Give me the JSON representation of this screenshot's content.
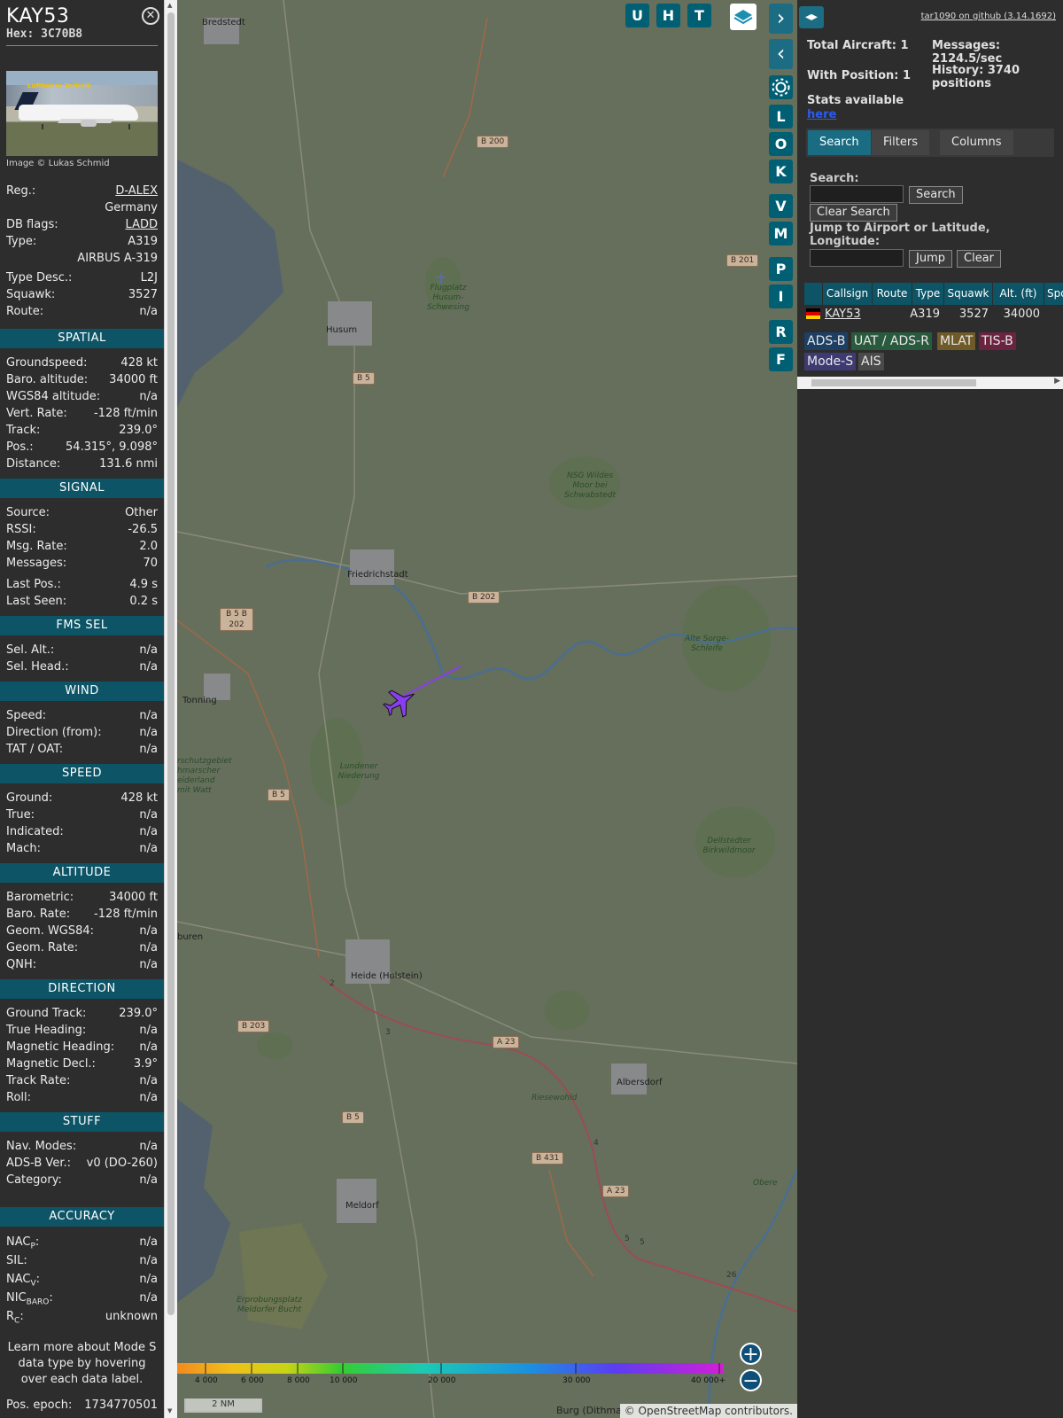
{
  "sidebar": {
    "callsign": "KAY53",
    "hex_label": "Hex:",
    "hex": "3C70B8",
    "close_icon": "close-icon",
    "photo_credit": "Image © Lukas Schmid",
    "photo_sign": "Lufthansa Technik",
    "info": [
      {
        "label": "Reg.:",
        "value": "D-ALEX",
        "link": true
      },
      {
        "label": "",
        "value": "Germany"
      },
      {
        "label": "DB flags:",
        "value": "LADD",
        "link": true
      },
      {
        "label": "Type:",
        "value": "A319"
      },
      {
        "label": "",
        "value": "AIRBUS A-319"
      }
    ],
    "info2": [
      {
        "label": "Type Desc.:",
        "value": "L2J"
      },
      {
        "label": "Squawk:",
        "value": "3527"
      },
      {
        "label": "Route:",
        "value": "n/a"
      }
    ],
    "sections": {
      "spatial": {
        "title": "SPATIAL",
        "rows": [
          {
            "label": "Groundspeed:",
            "value": "428 kt"
          },
          {
            "label": "Baro. altitude:",
            "value": "34000 ft"
          },
          {
            "label": "WGS84 altitude:",
            "value": "n/a"
          },
          {
            "label": "Vert. Rate:",
            "value": "-128 ft/min"
          },
          {
            "label": "Track:",
            "value": "239.0°"
          },
          {
            "label": "Pos.:",
            "value": "54.315°, 9.098°"
          },
          {
            "label": "Distance:",
            "value": "131.6 nmi"
          }
        ]
      },
      "signal": {
        "title": "SIGNAL",
        "rows": [
          {
            "label": "Source:",
            "value": "Other"
          },
          {
            "label": "RSSI:",
            "value": "-26.5"
          },
          {
            "label": "Msg. Rate:",
            "value": "2.0"
          },
          {
            "label": "Messages:",
            "value": "70"
          }
        ],
        "rows2": [
          {
            "label": "Last Pos.:",
            "value": "4.9 s"
          },
          {
            "label": "Last Seen:",
            "value": "0.2 s"
          }
        ]
      },
      "fms": {
        "title": "FMS SEL",
        "rows": [
          {
            "label": "Sel. Alt.:",
            "value": "n/a"
          },
          {
            "label": "Sel. Head.:",
            "value": "n/a"
          }
        ]
      },
      "wind": {
        "title": "WIND",
        "rows": [
          {
            "label": "Speed:",
            "value": "n/a"
          },
          {
            "label": "Direction (from):",
            "value": "n/a"
          },
          {
            "label": "TAT / OAT:",
            "value": "n/a"
          }
        ]
      },
      "speed": {
        "title": "SPEED",
        "rows": [
          {
            "label": "Ground:",
            "value": "428 kt"
          },
          {
            "label": "True:",
            "value": "n/a"
          },
          {
            "label": "Indicated:",
            "value": "n/a"
          },
          {
            "label": "Mach:",
            "value": "n/a"
          }
        ]
      },
      "altitude": {
        "title": "ALTITUDE",
        "rows": [
          {
            "label": "Barometric:",
            "value": "34000 ft"
          },
          {
            "label": "Baro. Rate:",
            "value": "-128 ft/min"
          },
          {
            "label": "Geom. WGS84:",
            "value": "n/a"
          },
          {
            "label": "Geom. Rate:",
            "value": "n/a"
          },
          {
            "label": "QNH:",
            "value": "n/a"
          }
        ]
      },
      "direction": {
        "title": "DIRECTION",
        "rows": [
          {
            "label": "Ground Track:",
            "value": "239.0°"
          },
          {
            "label": "True Heading:",
            "value": "n/a"
          },
          {
            "label": "Magnetic Heading:",
            "value": "n/a"
          },
          {
            "label": "Magnetic Decl.:",
            "value": "3.9°"
          },
          {
            "label": "Track Rate:",
            "value": "n/a"
          },
          {
            "label": "Roll:",
            "value": "n/a"
          }
        ]
      },
      "stuff": {
        "title": "STUFF",
        "rows": [
          {
            "label": "Nav. Modes:",
            "value": "n/a"
          },
          {
            "label": "ADS-B Ver.:",
            "value": "v0 (DO-260)"
          },
          {
            "label": "Category:",
            "value": "n/a"
          }
        ]
      },
      "accuracy": {
        "title": "ACCURACY",
        "rows": [
          {
            "label": "NACP:",
            "value": "n/a"
          },
          {
            "label": "SIL:",
            "value": "n/a"
          },
          {
            "label": "NACV:",
            "value": "n/a"
          },
          {
            "label": "NICBARO:",
            "value": "n/a"
          },
          {
            "label": "RC:",
            "value": "unknown"
          }
        ]
      }
    },
    "acc_labels": {
      "nac": "NAC",
      "p": "P",
      "v": "V",
      "nic": "NIC",
      "baro": "BARO",
      "r": "R",
      "c": "C",
      "colon": ":"
    },
    "note": "Learn more about Mode S data type by hovering over each data label.",
    "epoch_label": "Pos. epoch:",
    "epoch_value": "1734770501"
  },
  "map": {
    "top_buttons": [
      "U",
      "H",
      "T"
    ],
    "side_buttons": [
      "L",
      "O",
      "K",
      "V",
      "M",
      "P",
      "I",
      "R",
      "F"
    ],
    "settings_icon": "gear-icon",
    "layers_icon": "layers-icon",
    "next_icon": "chevron-right-icon",
    "prev_icon": "chevron-left-icon",
    "zoom_in": "+",
    "zoom_out": "−",
    "places": [
      "Bredstedt",
      "Husum",
      "Friedrichstadt",
      "Tonning",
      "Heide (Holstein)",
      "Albersdorf",
      "Meldorf",
      "buren",
      "Burg (Dithma"
    ],
    "green_labels": [
      "Flugplatz Husum-Schwesing",
      "NSG Wildes Moor bei Schwabstedt",
      "Alte Sorge-Schleife",
      "Lundener Niederung",
      "Dellstedter Birkwildmoor",
      "Riesewohld",
      "Obere",
      "Erprobungsplatz Meldorfer Bucht",
      "rschutzgebiet hmarscher eiderland mit Watt"
    ],
    "roads": [
      "B 200",
      "B 201",
      "B 5",
      "B 202",
      "B 5 B 202",
      "B 5",
      "B 203",
      "A 23",
      "B 5",
      "B 431",
      "A 23"
    ],
    "road_numbers": [
      "2",
      "3",
      "4",
      "5",
      "5",
      "26"
    ],
    "alt_scale": [
      "4 000",
      "6 000",
      "8 000",
      "10 000",
      "20 000",
      "30 000",
      "40 000+"
    ],
    "scale": "2 NM",
    "attribution_prefix": "© ",
    "attribution_link": "OpenStreetMap",
    "attribution_suffix": " contributors."
  },
  "right": {
    "github_link": "tar1090 on github (3.14.1692)",
    "toggle_icon": "expand-arrows-icon",
    "total_aircraft": "Total Aircraft: 1",
    "with_position": "With Position: 1",
    "messages": "Messages: 2124.5/sec",
    "history": "History: 3740 positions",
    "stats_text": "Stats available",
    "stats_link": "here",
    "tabs": [
      "Search",
      "Filters",
      "Columns"
    ],
    "search_label": "Search:",
    "search_button": "Search",
    "clear_search_button": "Clear Search",
    "jump_label": "Jump to Airport or Latitude, Longitude:",
    "jump_button": "Jump",
    "clear_button": "Clear",
    "table_headers": [
      "Callsign",
      "Route",
      "Type",
      "Squawk",
      "Alt. (ft)",
      "Spd."
    ],
    "table_row": {
      "flag": "germany-flag",
      "callsign": "KAY53",
      "route": "",
      "type": "A319",
      "squawk": "3527",
      "alt": "34000"
    },
    "badges": [
      {
        "label": "ADS-B",
        "bg": "#1d3f63",
        "fg": "#e8e8e8"
      },
      {
        "label": "UAT / ADS-R",
        "bg": "#2a5a3e",
        "fg": "#e8e8e8"
      },
      {
        "label": "MLAT",
        "bg": "#6f5a28",
        "fg": "#e8e8e8"
      },
      {
        "label": "TIS-B",
        "bg": "#6a2440",
        "fg": "#e8e8e8"
      },
      {
        "label": "Mode-S",
        "bg": "#3e3a72",
        "fg": "#e8e8e8"
      },
      {
        "label": "AIS",
        "bg": "#4a4a4a",
        "fg": "#e8e8e8"
      }
    ]
  },
  "colors": {
    "accent": "#0c5466",
    "button": "#015f73",
    "aircraft": "#8a3cf0"
  }
}
